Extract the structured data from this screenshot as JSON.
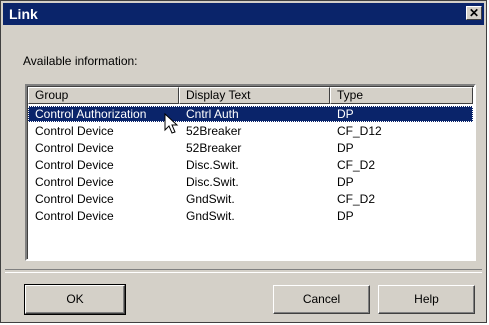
{
  "window": {
    "title": "Link",
    "close_glyph": "✕"
  },
  "available_label": "Available information:",
  "table": {
    "headers": [
      "Group",
      "Display Text",
      "Type"
    ],
    "rows": [
      [
        "Control Authorization",
        "Cntrl Auth",
        "DP"
      ],
      [
        "Control Device",
        "52Breaker",
        "CF_D12"
      ],
      [
        "Control Device",
        "52Breaker",
        "DP"
      ],
      [
        "Control Device",
        "Disc.Swit.",
        "CF_D2"
      ],
      [
        "Control Device",
        "Disc.Swit.",
        "DP"
      ],
      [
        "Control Device",
        "GndSwit.",
        "CF_D2"
      ],
      [
        "Control Device",
        "GndSwit.",
        "DP"
      ]
    ]
  },
  "buttons": {
    "ok": "OK",
    "cancel": "Cancel",
    "help": "Help"
  },
  "colors": {
    "titlebar": "#0a246a",
    "selection": "#0a246a",
    "face": "#d4d0c8"
  }
}
